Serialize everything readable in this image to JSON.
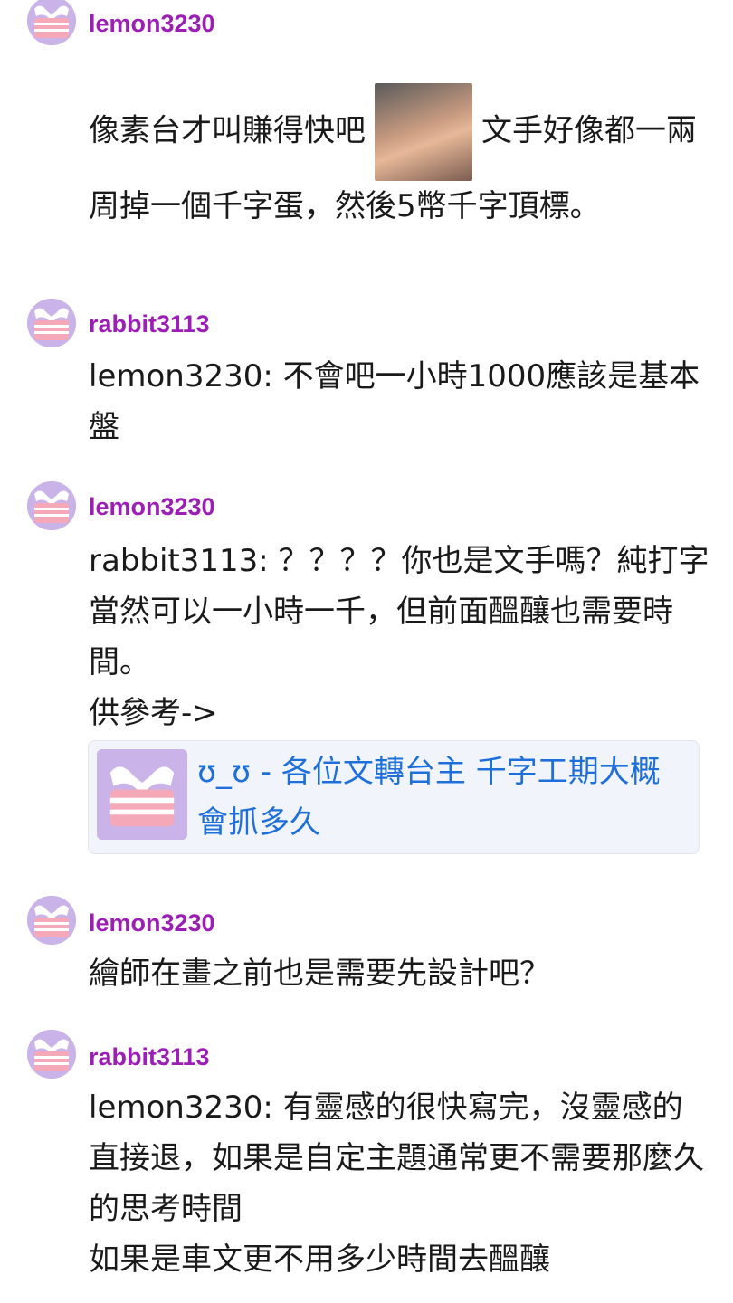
{
  "posts": [
    {
      "username": "lemon3230",
      "text_before_image": "像素台才叫賺得快吧",
      "image_icon": "face-photo",
      "text_after_image": "文手好像都一兩周掉一個千字蛋，然後5幣千字頂標。"
    },
    {
      "username": "rabbit3113",
      "text": "lemon3230: 不會吧一小時1000應該是基本盤"
    },
    {
      "username": "lemon3230",
      "text": "rabbit3113: ？？？？你也是文手嗎？純打字當然可以一小時一千，但前面醞釀也需要時間。\n供參考->",
      "link_card": {
        "thumb_icon": "mask-avatar",
        "title": "ʊ_ʊ - 各位文轉台主 千字工期大概會抓多久"
      }
    },
    {
      "username": "lemon3230",
      "text": "繪師在畫之前也是需要先設計吧？"
    },
    {
      "username": "rabbit3113",
      "text": "lemon3230: 有靈感的很快寫完，沒靈感的直接退，如果是自定主題通常更不需要那麼久的思考時間\n如果是車文更不用多少時間去醞釀"
    }
  ],
  "colors": {
    "username": "#9b1fb4",
    "link": "#1e6fd9",
    "avatar_bg": "#c9b3e8",
    "mask_stripes": "#f4a8b8",
    "card_bg": "#f1f4fb"
  }
}
